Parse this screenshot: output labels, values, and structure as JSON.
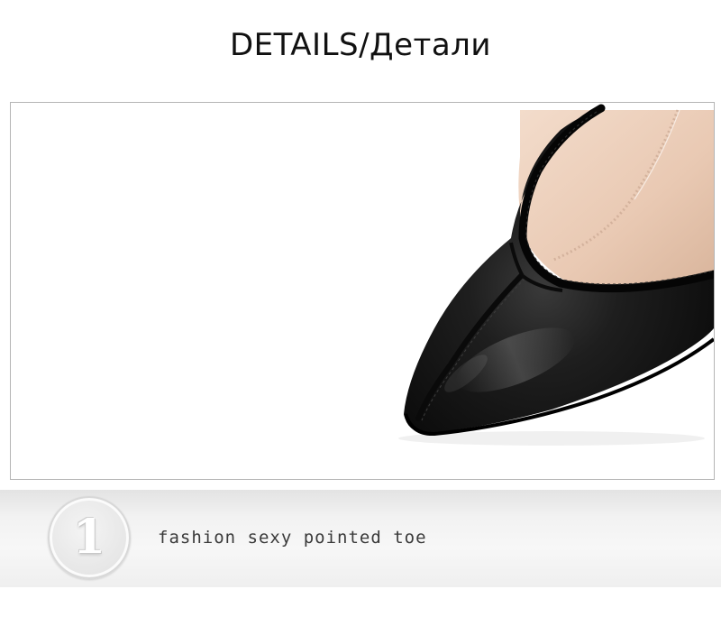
{
  "header": {
    "title": "DETAILS/Детали"
  },
  "photo": {
    "subject": "black-pointed-toe-shoe"
  },
  "features": [
    {
      "number": "1",
      "text": "fashion sexy pointed toe"
    }
  ],
  "colors": {
    "shoe": "#141414",
    "lining": "#e8cdb9",
    "band": "#f2f2f2"
  }
}
